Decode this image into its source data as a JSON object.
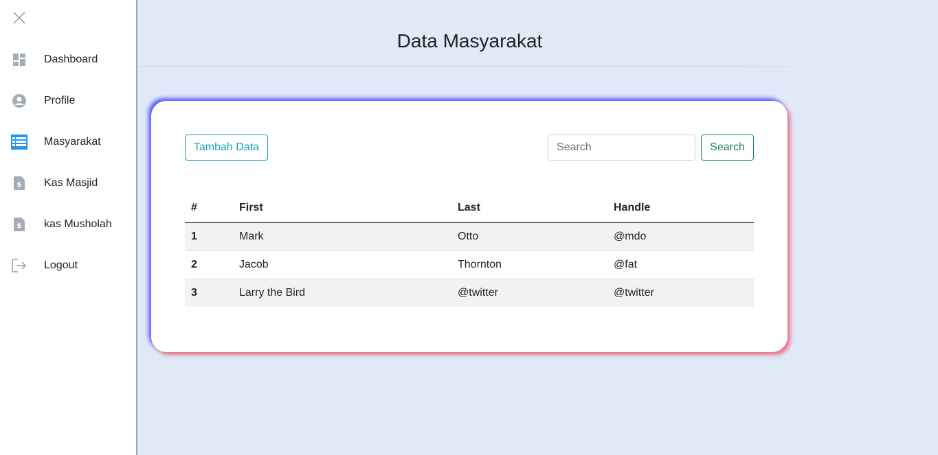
{
  "sidebar": {
    "close_icon": "close-icon",
    "items": [
      {
        "label": "Dashboard",
        "icon": "dashboard-icon"
      },
      {
        "label": "Profile",
        "icon": "user-circle-icon"
      },
      {
        "label": "Masyarakat",
        "icon": "table-icon",
        "active": true
      },
      {
        "label": "Kas Masjid",
        "icon": "dollar-document-icon"
      },
      {
        "label": "kas Musholah",
        "icon": "dollar-document-icon"
      },
      {
        "label": "Logout",
        "icon": "logout-icon"
      }
    ]
  },
  "main": {
    "title": "Data Masyarakat",
    "add_button": "Tambah Data",
    "search_placeholder": "Search",
    "search_button": "Search",
    "table": {
      "headers": [
        "#",
        "First",
        "Last",
        "Handle"
      ],
      "rows": [
        [
          "1",
          "Mark",
          "Otto",
          "@mdo"
        ],
        [
          "2",
          "Jacob",
          "Thornton",
          "@fat"
        ],
        [
          "3",
          "Larry the Bird",
          "@twitter",
          "@twitter"
        ]
      ]
    }
  },
  "colors": {
    "page_bg": "#dfe9f7",
    "accent_info": "#17a2b8",
    "accent_success": "#198754",
    "active_icon": "#2196f3",
    "inactive_icon": "#a3adb8"
  }
}
